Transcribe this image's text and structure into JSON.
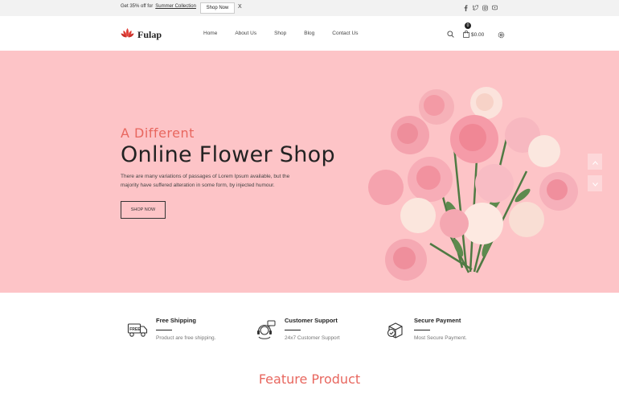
{
  "topbar": {
    "promo_text": "Get 35% off for",
    "promo_link": "Summer Collection",
    "shop_now": "Shop Now",
    "close": "X",
    "socials": [
      "facebook-icon",
      "twitter-icon",
      "instagram-icon",
      "youtube-icon"
    ]
  },
  "header": {
    "logo_text": "Fulap",
    "nav": [
      "Home",
      "About Us",
      "Shop",
      "Blog",
      "Contact Us"
    ],
    "cart_count": "0",
    "cart_total": "$0.00",
    "accent_color": "#e8675f"
  },
  "hero": {
    "subtitle": "A Different",
    "title": "Online Flower Shop",
    "description": "There are many variations of passages of Lorem Ipsum available, but the majority have suffered alteration in some form, by injected humour.",
    "cta": "SHOP NOW",
    "background": "#fdc4c7"
  },
  "features": [
    {
      "title": "Free Shipping",
      "desc": "Product are free shipping.",
      "icon": "free-delivery-truck-icon"
    },
    {
      "title": "Customer Support",
      "desc": "24x7 Customer Support",
      "icon": "support-headset-icon"
    },
    {
      "title": "Secure Payment",
      "desc": "Most Secure Payment.",
      "icon": "secure-payment-box-icon"
    }
  ],
  "section": {
    "title": "Feature Product"
  }
}
